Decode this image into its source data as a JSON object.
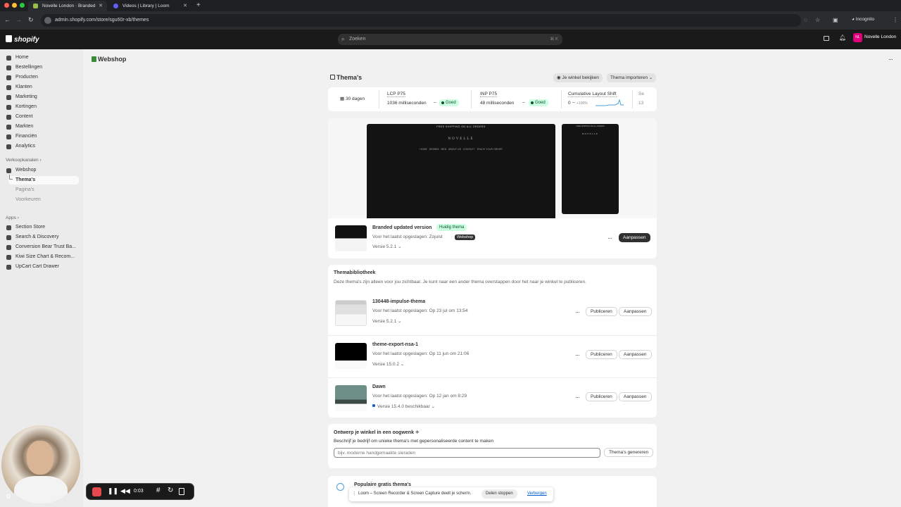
{
  "browser": {
    "tabs": [
      {
        "label": "Novelle London · Branded"
      },
      {
        "label": "Videos | Library | Loom"
      }
    ],
    "new_tab": "+",
    "url": "admin.shopify.com/store/sgu60r-xb/themes",
    "incognito_label": "Incognito"
  },
  "topbar": {
    "logo": "shopify",
    "search_placeholder": "Zoeken",
    "search_shortcut": "⌘ K",
    "store_initials": "NL",
    "store_name": "Novelle London"
  },
  "sidebar": {
    "items": [
      {
        "label": "Home",
        "icon": "home-icon"
      },
      {
        "label": "Bestellingen",
        "icon": "inbox-icon"
      },
      {
        "label": "Producten",
        "icon": "tag-icon"
      },
      {
        "label": "Klanten",
        "icon": "person-icon"
      },
      {
        "label": "Marketing",
        "icon": "target-icon"
      },
      {
        "label": "Kortingen",
        "icon": "discount-icon"
      },
      {
        "label": "Content",
        "icon": "content-icon"
      },
      {
        "label": "Markten",
        "icon": "globe-icon"
      },
      {
        "label": "Financiën",
        "icon": "bank-icon"
      },
      {
        "label": "Analytics",
        "icon": "chart-icon"
      }
    ],
    "sales_channels_header": "Verkoopkanalen",
    "channel": {
      "label": "Webshop",
      "icon": "store-icon"
    },
    "channel_subitems": [
      "Thema's",
      "Pagina's",
      "Voorkeuren"
    ],
    "apps_header": "Apps",
    "apps": [
      {
        "label": "Section Store"
      },
      {
        "label": "Search & Discovery"
      },
      {
        "label": "Conversion Bear Trust Ba..."
      },
      {
        "label": "Kiwi Size Chart & Recom..."
      },
      {
        "label": "UpCart Cart Drawer"
      }
    ]
  },
  "page": {
    "breadcrumb": "Webshop",
    "title": "Thema's",
    "view_store": "Je winkel bekijken",
    "import_theme": "Thema importeren"
  },
  "metrics": {
    "period": "30 dagen",
    "items": [
      {
        "label": "LCP P75",
        "value": "1036 milliseconden",
        "status": "Goed"
      },
      {
        "label": "INP P75",
        "value": "48 milliseconden",
        "status": "Goed"
      },
      {
        "label": "Cumulative Layout Shift",
        "value": "0",
        "delta": "+100%"
      },
      {
        "label": "Se",
        "value": "13"
      }
    ]
  },
  "preview": {
    "banner": "FREE SHIPPING ON ALL ORDERS",
    "brand": "NOVELLE",
    "nav": [
      "HOME",
      "WOMEN",
      "MEN",
      "ABOUT US",
      "CONTACT",
      "TRACK YOUR ORDER"
    ]
  },
  "current_theme": {
    "name": "Branded updated version",
    "badge": "Huidig thema",
    "tooltip": "Webshop",
    "saved": "Voor het laatst opgeslagen: Zojuist",
    "version": "Versie 5.2.1",
    "customize": "Aanpassen"
  },
  "library": {
    "title": "Themabibliotheek",
    "description": "Deze thema's zijn alleen voor jou zichtbaar. Je kunt naar een ander thema overstappen door het naar je winkel te publiceren.",
    "publish_label": "Publiceren",
    "customize_label": "Aanpassen",
    "themes": [
      {
        "name": "130448-impulse-thema",
        "saved": "Voor het laatst opgeslagen: Op 23 jul om 13:54",
        "version": "Versie 5.2.1"
      },
      {
        "name": "theme-export-nsa-1",
        "saved": "Voor het laatst opgeslagen: Op 11 jun om 21:06",
        "version": "Versie 15.0.2"
      },
      {
        "name": "Dawn",
        "saved": "Voor het laatst opgeslagen: Op 12 jan om 8:29",
        "version": "Versie 15.4.0 beschikbaar"
      }
    ]
  },
  "design": {
    "title": "Ontwerp je winkel in een oogwenk",
    "subtitle": "Beschrijf je bedrijf om unieke thema's met gepersonaliseerde content te maken",
    "placeholder": "bijv. moderne handgemaakte sieraden",
    "generate": "Thema's genereren"
  },
  "popular": {
    "title": "Populaire gratis thema's"
  },
  "loom": {
    "timer": "0:03",
    "share_text": "Loom – Screen Recorder & Screen Capture deelt je scherm.",
    "stop_sharing": "Delen stoppen",
    "hide": "Verbergen"
  },
  "colors": {
    "shopify_dark": "#1a1a1a",
    "success_bg": "#cdfee1",
    "success_fg": "#0c5132",
    "record_red": "#e5484d",
    "link_blue": "#005bd3"
  }
}
